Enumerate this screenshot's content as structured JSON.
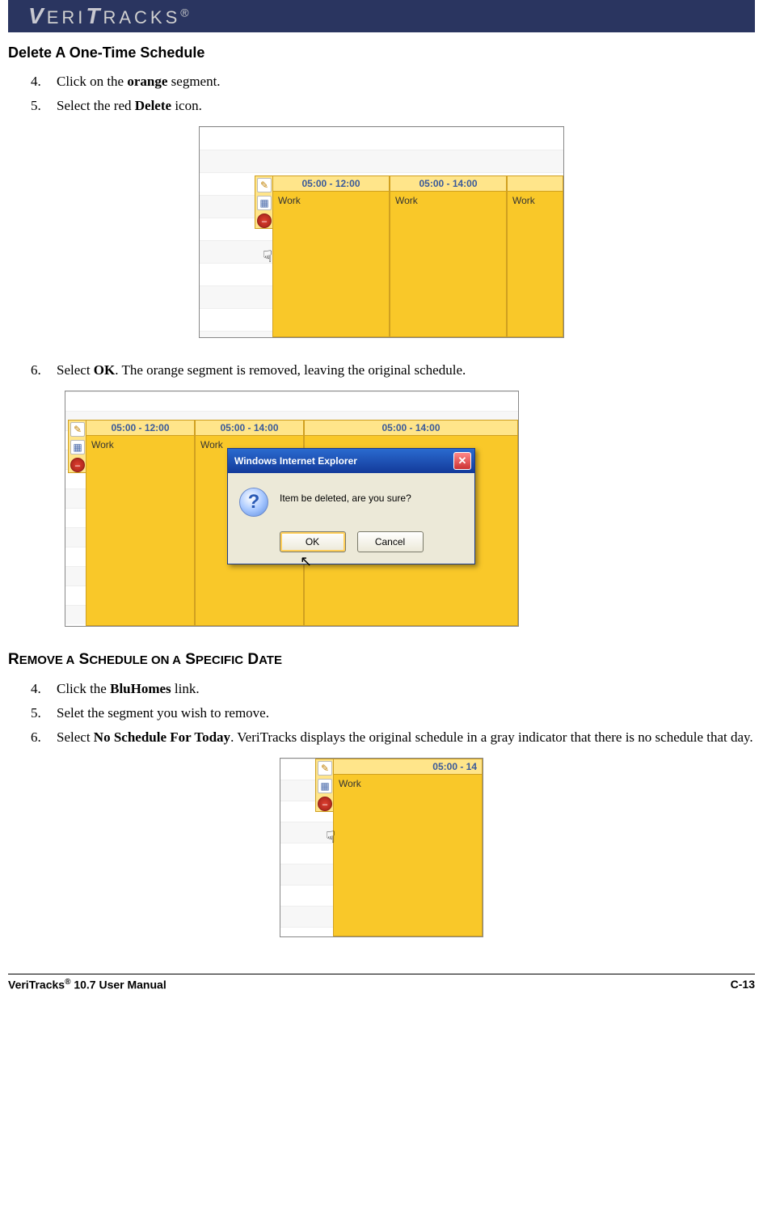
{
  "header": {
    "brand": "VERITRACKS",
    "reg": "®"
  },
  "section1": {
    "title": "Delete A One-Time Schedule",
    "step4_pre": "Click on the ",
    "step4_b": "orange",
    "step4_post": " segment.",
    "step5_pre": "Select the red ",
    "step5_b": "Delete",
    "step5_post": " icon.",
    "step6_pre": "Select ",
    "step6_b": "OK",
    "step6_post": ". The orange segment is removed, leaving the original schedule."
  },
  "fig1": {
    "col1_time": "05:00 - 12:00",
    "col1_label": "Work",
    "col2_time": "05:00 - 14:00",
    "col2_label": "Work",
    "col3_label": "Work"
  },
  "fig2": {
    "colA_time": "05:00 - 12:00",
    "colA_label": "Work",
    "colB_time": "05:00 - 14:00",
    "colB_label": "Work",
    "colC_time": "05:00 - 14:00",
    "dialog_title": "Windows Internet Explorer",
    "dialog_msg": "Item be deleted, are you sure?",
    "ok": "OK",
    "cancel": "Cancel"
  },
  "section2": {
    "title": "Remove a Schedule on a Specific Date",
    "step4_pre": "Click the ",
    "step4_b": "BluHomes",
    "step4_post": " link.",
    "step5": "Selet the segment you wish to remove.",
    "step6_pre": "Select ",
    "step6_b": "No Schedule For Today",
    "step6_post": ". VeriTracks displays the original schedule in a gray indicator that there is no schedule that day."
  },
  "fig3": {
    "col_time": "05:00 - 14",
    "col_label": "Work"
  },
  "footer": {
    "left_a": "VeriTracks",
    "left_sup": "®",
    "left_b": " 10.7 User Manual",
    "right": "C-13"
  }
}
